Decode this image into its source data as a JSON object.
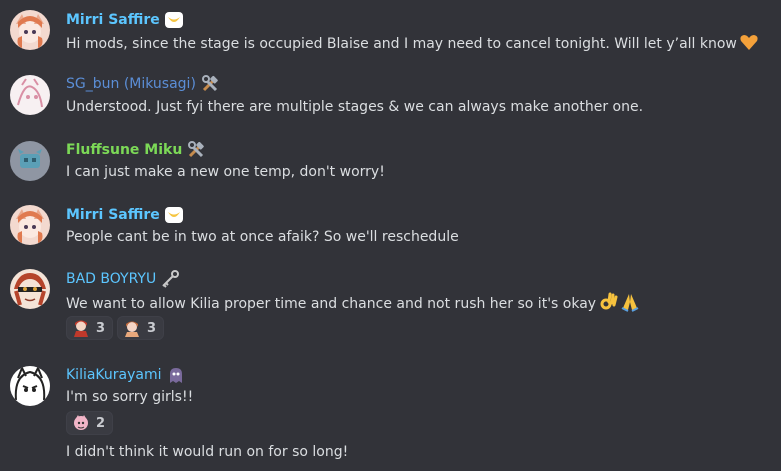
{
  "messages": [
    {
      "author": "Mirri Saffire",
      "color": "#5cc6ff",
      "badge": "crescent-icon",
      "text": "Hi mods, since the stage is occupied Blaise and I may need to cancel tonight. Will let y’all know",
      "emoji": [
        "orange-heart-icon"
      ]
    },
    {
      "author": "SG_bun (Mikusagi)",
      "color": "#5b8ed6",
      "badge": "hammer-wrench-icon",
      "text": "Understood. Just fyi there are multiple stages & we can always make another one."
    },
    {
      "author": "Fluffsune Miku",
      "color": "#7cd957",
      "badge": "hammer-wrench-icon",
      "text": "I can just make a new one temp, don't worry!"
    },
    {
      "author": "Mirri Saffire",
      "color": "#5cc6ff",
      "badge": "crescent-icon",
      "text": "People cant be in two at once afaik? So we'll reschedule"
    },
    {
      "author": "BAD BOYRYU",
      "color": "#5cc6ff",
      "badge": "key-icon",
      "text": "We want to allow Kilia proper time and chance and not rush her so it's okay",
      "emoji": [
        "ok-hand-icon",
        "folded-hands-icon"
      ],
      "reactions": [
        {
          "emoji": "girl-emote-icon",
          "count": "3"
        },
        {
          "emoji": "girl-emote-icon",
          "count": "3"
        }
      ]
    },
    {
      "author": "KiliaKurayami",
      "color": "#5cc6ff",
      "badge": "ghost-emote-icon",
      "text": "I'm so sorry girls!!",
      "reactions": [
        {
          "emoji": "pink-emote-icon",
          "count": "2"
        }
      ],
      "followup": "I didn't think it would run on for so long!"
    }
  ]
}
